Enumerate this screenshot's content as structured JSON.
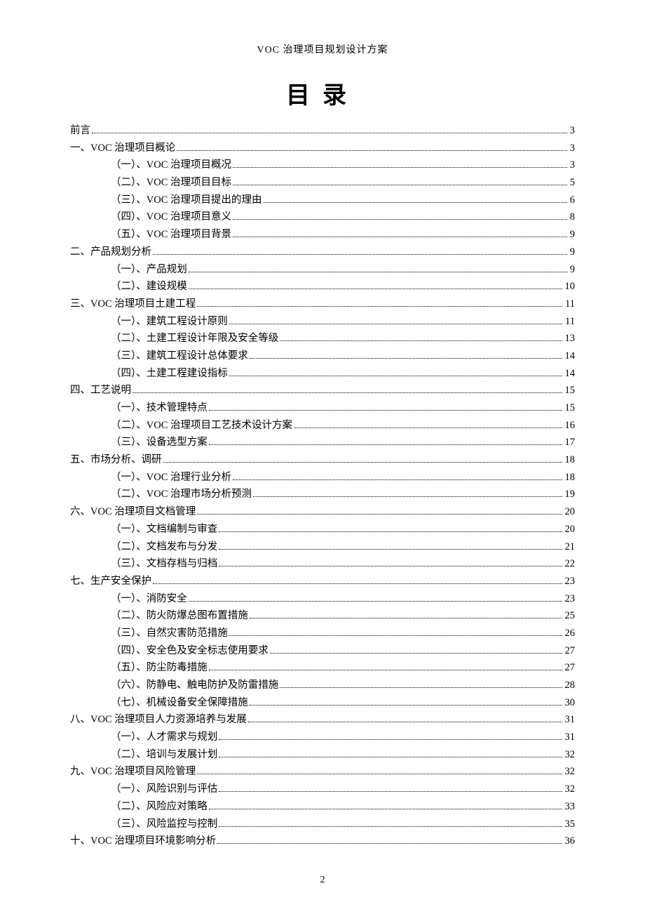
{
  "running_head": "VOC 治理项目规划设计方案",
  "title": "目录",
  "page_number": "2",
  "toc": [
    {
      "level": 0,
      "label": "前言",
      "page": "3"
    },
    {
      "level": 0,
      "label": "一、VOC 治理项目概论",
      "page": "3"
    },
    {
      "level": 1,
      "label": "（一）、VOC 治理项目概况",
      "page": "3"
    },
    {
      "level": 1,
      "label": "（二）、VOC 治理项目目标",
      "page": "5"
    },
    {
      "level": 1,
      "label": "（三）、VOC 治理项目提出的理由",
      "page": "6"
    },
    {
      "level": 1,
      "label": "（四）、VOC 治理项目意义",
      "page": "8"
    },
    {
      "level": 1,
      "label": "（五）、VOC 治理项目背景",
      "page": "9"
    },
    {
      "level": 0,
      "label": "二、产品规划分析",
      "page": "9"
    },
    {
      "level": 1,
      "label": "（一）、产品规划",
      "page": "9"
    },
    {
      "level": 1,
      "label": "（二）、建设规模",
      "page": "10"
    },
    {
      "level": 0,
      "label": "三、VOC 治理项目土建工程",
      "page": "11"
    },
    {
      "level": 1,
      "label": "（一）、建筑工程设计原则",
      "page": "11"
    },
    {
      "level": 1,
      "label": "（二）、土建工程设计年限及安全等级",
      "page": "13"
    },
    {
      "level": 1,
      "label": "（三）、建筑工程设计总体要求",
      "page": "14"
    },
    {
      "level": 1,
      "label": "（四）、土建工程建设指标",
      "page": "14"
    },
    {
      "level": 0,
      "label": "四、工艺说明",
      "page": "15"
    },
    {
      "level": 1,
      "label": "（一）、技术管理特点",
      "page": "15"
    },
    {
      "level": 1,
      "label": "（二）、VOC 治理项目工艺技术设计方案",
      "page": "16"
    },
    {
      "level": 1,
      "label": "（三）、设备选型方案",
      "page": "17"
    },
    {
      "level": 0,
      "label": "五、市场分析、调研",
      "page": "18"
    },
    {
      "level": 1,
      "label": "（一）、VOC 治理行业分析",
      "page": "18"
    },
    {
      "level": 1,
      "label": "（二）、VOC 治理市场分析预测",
      "page": "19"
    },
    {
      "level": 0,
      "label": "六、VOC 治理项目文档管理",
      "page": "20"
    },
    {
      "level": 1,
      "label": "（一）、文档编制与审查",
      "page": "20"
    },
    {
      "level": 1,
      "label": "（二）、文档发布与分发",
      "page": "21"
    },
    {
      "level": 1,
      "label": "（三）、文档存档与归档",
      "page": "22"
    },
    {
      "level": 0,
      "label": "七、生产安全保护",
      "page": "23"
    },
    {
      "level": 1,
      "label": "（一）、消防安全",
      "page": "23"
    },
    {
      "level": 1,
      "label": "（二）、防火防爆总图布置措施",
      "page": "25"
    },
    {
      "level": 1,
      "label": "（三）、自然灾害防范措施",
      "page": "26"
    },
    {
      "level": 1,
      "label": "（四）、安全色及安全标志使用要求",
      "page": "27"
    },
    {
      "level": 1,
      "label": "（五）、防尘防毒措施",
      "page": "27"
    },
    {
      "level": 1,
      "label": "（六）、防静电、触电防护及防雷措施",
      "page": "28"
    },
    {
      "level": 1,
      "label": "（七）、机械设备安全保障措施",
      "page": "30"
    },
    {
      "level": 0,
      "label": "八、VOC 治理项目人力资源培养与发展",
      "page": "31"
    },
    {
      "level": 1,
      "label": "（一）、人才需求与规划",
      "page": "31"
    },
    {
      "level": 1,
      "label": "（二）、培训与发展计划",
      "page": "32"
    },
    {
      "level": 0,
      "label": "九、VOC 治理项目风险管理",
      "page": "32"
    },
    {
      "level": 1,
      "label": "（一）、风险识别与评估",
      "page": "32"
    },
    {
      "level": 1,
      "label": "（二）、风险应对策略",
      "page": "33"
    },
    {
      "level": 1,
      "label": "（三）、风险监控与控制",
      "page": "35"
    },
    {
      "level": 0,
      "label": "十、VOC 治理项目环境影响分析",
      "page": "36"
    }
  ]
}
